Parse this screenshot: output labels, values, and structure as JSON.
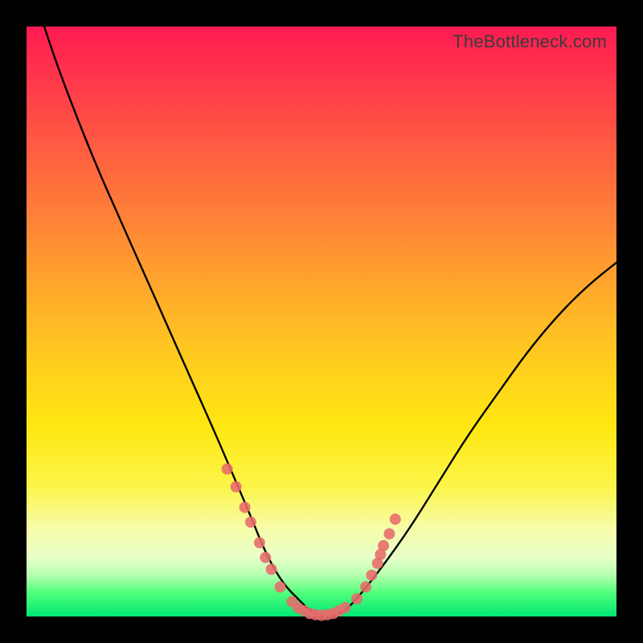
{
  "watermark": "TheBottleneck.com",
  "chart_data": {
    "type": "line",
    "title": "",
    "xlabel": "",
    "ylabel": "",
    "xlim": [
      0,
      100
    ],
    "ylim": [
      0,
      100
    ],
    "series": [
      {
        "name": "bottleneck-curve",
        "x": [
          3,
          5,
          8,
          12,
          16,
          20,
          24,
          28,
          32,
          35,
          38,
          40,
          42,
          44,
          46,
          48,
          50,
          52,
          54,
          56,
          60,
          65,
          70,
          75,
          80,
          85,
          90,
          95,
          100
        ],
        "y": [
          100,
          94,
          86,
          76,
          67,
          58,
          49,
          40,
          31,
          24,
          17,
          12,
          8,
          5,
          3,
          1,
          0,
          0,
          1,
          3,
          8,
          15,
          23,
          31,
          38,
          45,
          51,
          56,
          60
        ]
      }
    ],
    "markers": {
      "name": "sample-points",
      "color": "#e86b6b",
      "points": [
        {
          "x": 34,
          "y": 25
        },
        {
          "x": 35.5,
          "y": 22
        },
        {
          "x": 37,
          "y": 18.5
        },
        {
          "x": 38,
          "y": 16
        },
        {
          "x": 39.5,
          "y": 12.5
        },
        {
          "x": 40.5,
          "y": 10
        },
        {
          "x": 41.5,
          "y": 8
        },
        {
          "x": 43,
          "y": 5
        },
        {
          "x": 45,
          "y": 2.5
        },
        {
          "x": 46,
          "y": 1.5
        },
        {
          "x": 47,
          "y": 1
        },
        {
          "x": 48,
          "y": 0.5
        },
        {
          "x": 49,
          "y": 0.3
        },
        {
          "x": 50,
          "y": 0.2
        },
        {
          "x": 51,
          "y": 0.3
        },
        {
          "x": 52,
          "y": 0.5
        },
        {
          "x": 53,
          "y": 1
        },
        {
          "x": 54,
          "y": 1.5
        },
        {
          "x": 56,
          "y": 3
        },
        {
          "x": 57.5,
          "y": 5
        },
        {
          "x": 58.5,
          "y": 7
        },
        {
          "x": 59.5,
          "y": 9
        },
        {
          "x": 60,
          "y": 10.5
        },
        {
          "x": 60.5,
          "y": 12
        },
        {
          "x": 61.5,
          "y": 14
        },
        {
          "x": 62.5,
          "y": 16.5
        }
      ]
    },
    "gradient_stops": [
      {
        "pos": 0,
        "color": "#ff1a52"
      },
      {
        "pos": 25,
        "color": "#ff6a3e"
      },
      {
        "pos": 55,
        "color": "#ffc820"
      },
      {
        "pos": 78,
        "color": "#fbf54a"
      },
      {
        "pos": 93,
        "color": "#b6ffb0"
      },
      {
        "pos": 100,
        "color": "#00e874"
      }
    ]
  }
}
